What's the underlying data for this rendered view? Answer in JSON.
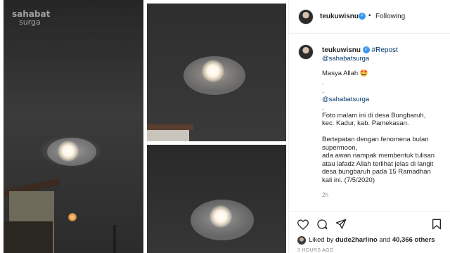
{
  "watermark": {
    "brand": "sahabat",
    "sub": "surga"
  },
  "post": {
    "header": {
      "username": "teukuwisnu",
      "separator": "•",
      "follow_label": "Following"
    },
    "caption": {
      "username": "teukuwisnu",
      "repost_tag": "#Repost",
      "mention": "@sahabatsurga",
      "lines": [
        "Masya Allah 🤩",
        ".",
        ".",
        "@sahabatsurga",
        ".",
        "Foto malam ini di desa Bungbaruh,",
        "kec. Kadur, kab. Pamekasan.",
        "",
        "Bertepatan dengan fenomena bulan",
        "supermoon,",
        "ada awan nampak membentuk tulisan",
        "atau lafadz Allah terlihat jelas di langit",
        "desa bungbaruh pada 15 Ramadhan",
        "kali ini. (7/5/2020)"
      ],
      "time_ago": "2h"
    },
    "likes": {
      "prefix": "Liked by",
      "first_liker": "dude2harlino",
      "connector": "and",
      "others": "40,366 others"
    },
    "posted_ago": "3 HOURS AGO"
  },
  "icons": {
    "like": "heart-icon",
    "comment": "comment-icon",
    "share": "share-icon",
    "save": "bookmark-icon",
    "verified": "verified-badge-icon"
  },
  "colors": {
    "verified": "#3897f0",
    "link": "#00376b",
    "muted": "#8e8e8e"
  }
}
